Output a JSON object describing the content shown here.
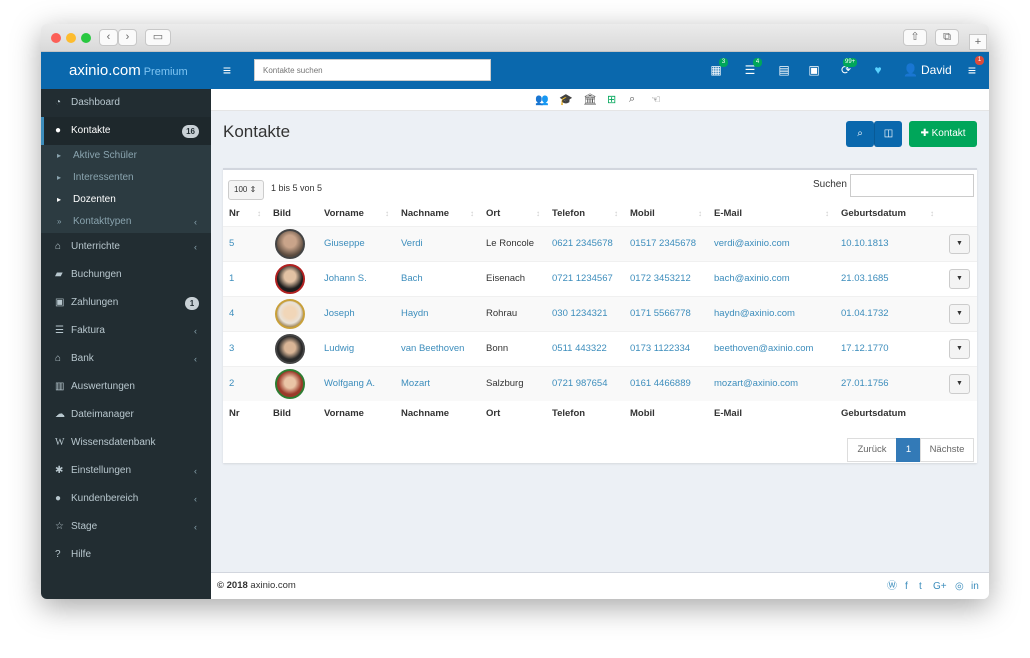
{
  "app": {
    "brand": "axinio.com",
    "brand_sub": "Premium"
  },
  "navbar": {
    "search_placeholder": "Kontakte suchen",
    "badges": [
      "3",
      "4",
      "99+",
      "1"
    ],
    "user": "David"
  },
  "sidebar": {
    "items": [
      {
        "label": "Dashboard",
        "icon": "dashboard-icon"
      },
      {
        "label": "Kontakte",
        "icon": "users-icon",
        "count": "16"
      },
      {
        "label": "Unterrichte",
        "icon": "graduation-cap-icon"
      },
      {
        "label": "Buchungen",
        "icon": "book-icon"
      },
      {
        "label": "Zahlungen",
        "icon": "money-icon",
        "count": "1"
      },
      {
        "label": "Faktura",
        "icon": "list-icon"
      },
      {
        "label": "Bank",
        "icon": "bank-icon"
      },
      {
        "label": "Auswertungen",
        "icon": "bar-chart-icon"
      },
      {
        "label": "Dateimanager",
        "icon": "cloud-icon"
      },
      {
        "label": "Wissensdatenbank",
        "icon": "wikipedia-icon"
      },
      {
        "label": "Einstellungen",
        "icon": "gear-icon"
      },
      {
        "label": "Kundenbereich",
        "icon": "user-icon"
      },
      {
        "label": "Stage",
        "icon": "star-icon"
      },
      {
        "label": "Hilfe",
        "icon": "question-icon"
      }
    ],
    "sub_items": [
      {
        "label": "Aktive Schüler"
      },
      {
        "label": "Interessenten"
      },
      {
        "label": "Dozenten"
      },
      {
        "label": "Kontakttypen"
      }
    ]
  },
  "main": {
    "title": "Kontakte",
    "add_button": "Kontakt",
    "page_size": "100",
    "info": "1 bis 5 von 5",
    "search_label": "Suchen",
    "columns": [
      "Nr",
      "Bild",
      "Vorname",
      "Nachname",
      "Ort",
      "Telefon",
      "Mobil",
      "E-Mail",
      "Geburtsdatum"
    ],
    "rows": [
      {
        "nr": "5",
        "vorname": "Giuseppe",
        "nachname": "Verdi",
        "ort": "Le Roncole",
        "telefon": "0621 2345678",
        "mobil": "01517 2345678",
        "email": "verdi@axinio.com",
        "geb": "10.10.1813"
      },
      {
        "nr": "1",
        "vorname": "Johann S.",
        "nachname": "Bach",
        "ort": "Eisenach",
        "telefon": "0721 1234567",
        "mobil": "0172 3453212",
        "email": "bach@axinio.com",
        "geb": "21.03.1685"
      },
      {
        "nr": "4",
        "vorname": "Joseph",
        "nachname": "Haydn",
        "ort": "Rohrau",
        "telefon": "030 1234321",
        "mobil": "0171 5566778",
        "email": "haydn@axinio.com",
        "geb": "01.04.1732"
      },
      {
        "nr": "3",
        "vorname": "Ludwig",
        "nachname": "van Beethoven",
        "ort": "Bonn",
        "telefon": "0511 443322",
        "mobil": "0173 1122334",
        "email": "beethoven@axinio.com",
        "geb": "17.12.1770"
      },
      {
        "nr": "2",
        "vorname": "Wolfgang A.",
        "nachname": "Mozart",
        "ort": "Salzburg",
        "telefon": "0721 987654",
        "mobil": "0161 4466889",
        "email": "mozart@axinio.com",
        "geb": "27.01.1756"
      }
    ],
    "pagination": {
      "prev": "Zurück",
      "current": "1",
      "next": "Nächste"
    }
  },
  "footer": {
    "year": "© 2018",
    "site": "axinio.com"
  },
  "colors": {
    "primary": "#0a68ad",
    "success": "#00a65a",
    "sidebar": "#222d32"
  }
}
